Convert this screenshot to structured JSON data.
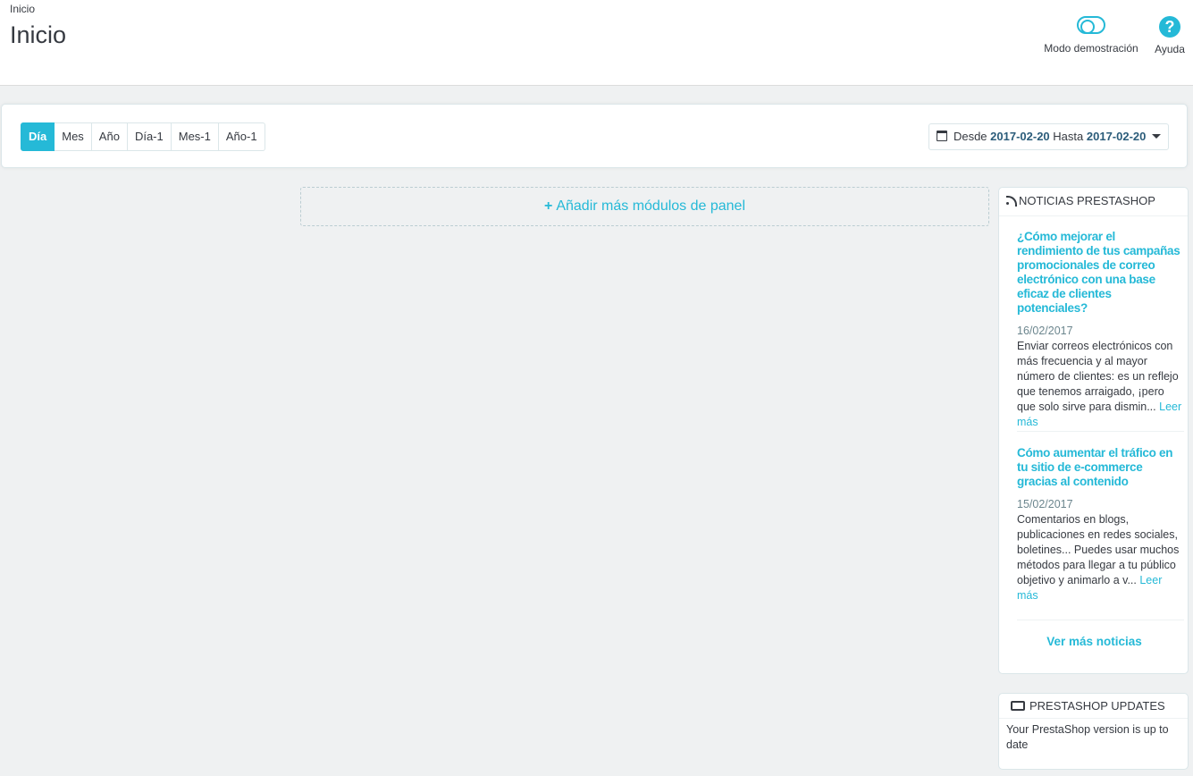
{
  "header": {
    "breadcrumb": "Inicio",
    "title": "Inicio",
    "demo_mode_label": "Modo demostración",
    "help_label": "Ayuda",
    "help_glyph": "?"
  },
  "toolbar": {
    "periods": [
      "Día",
      "Mes",
      "Año",
      "Día-1",
      "Mes-1",
      "Año-1"
    ],
    "active_period": "Día",
    "date_range": {
      "from_label": "Desde",
      "from": "2017-02-20",
      "to_label": "Hasta",
      "to": "2017-02-20"
    }
  },
  "main": {
    "add_modules_icon": "+",
    "add_modules_label": "Añadir más módulos de panel"
  },
  "news": {
    "heading": "NOTICIAS PRESTASHOP",
    "articles": [
      {
        "title": "¿Cómo mejorar el rendimiento de tus campañas promocionales de correo electrónico con una base eficaz de clientes potenciales?",
        "date": "16/02/2017",
        "excerpt": "Enviar correos electrónicos con más frecuencia y al mayor número de clientes: es un reflejo que tenemos arraigado, ¡pero que solo sirve para dismin...",
        "read_more": "Leer más"
      },
      {
        "title": "Cómo aumentar el tráfico en tu sitio de e-commerce gracias al contenido",
        "date": "15/02/2017",
        "excerpt": "Comentarios en blogs, publicaciones en redes sociales, boletines... Puedes usar muchos métodos para llegar a tu público objetivo y animarlo a v...",
        "read_more": "Leer más"
      }
    ],
    "more_news": "Ver más noticias"
  },
  "updates": {
    "heading": "PRESTASHOP UPDATES",
    "message": "Your PrestaShop version is up to date"
  },
  "colors": {
    "accent": "#25b9d7",
    "background": "#eff1f2",
    "text": "#363a41"
  }
}
